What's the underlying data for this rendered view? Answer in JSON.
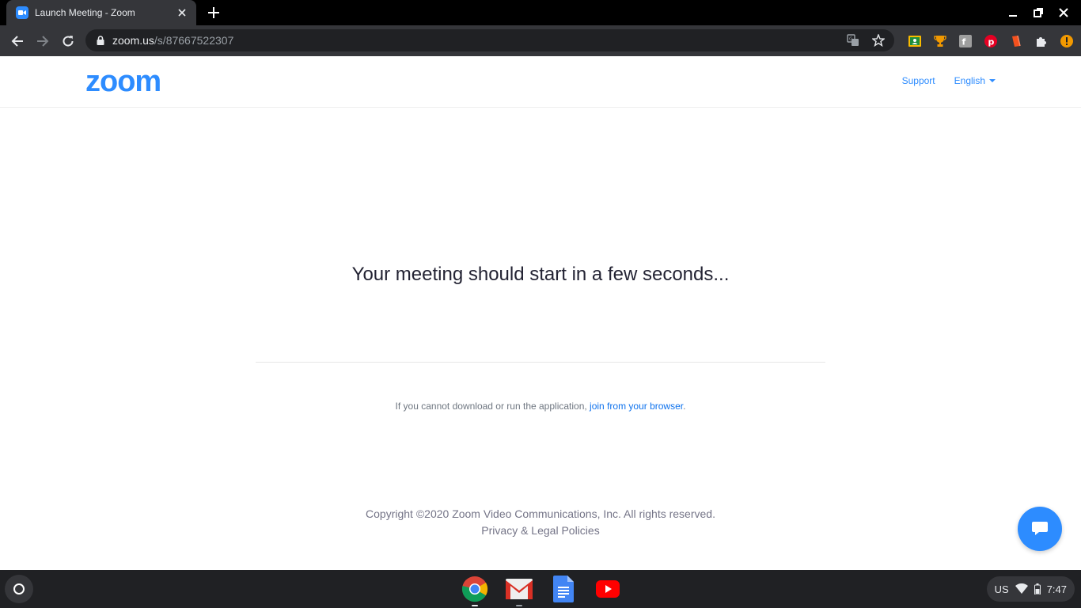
{
  "browser": {
    "tab_title": "Launch Meeting - Zoom",
    "url_host": "zoom.us",
    "url_path": "/s/87667522307"
  },
  "header": {
    "logo_text": "zoom",
    "support_label": "Support",
    "language_label": "English"
  },
  "main": {
    "headline": "Your meeting should start in a few seconds...",
    "help_prefix": "If you cannot download or run the application, ",
    "help_link": "join from your browser",
    "help_suffix": "."
  },
  "footer": {
    "copyright": "Copyright ©2020 Zoom Video Communications, Inc. All rights reserved.",
    "privacy": "Privacy & Legal Policies"
  },
  "shelf": {
    "apps": [
      "chrome-icon",
      "gmail-icon",
      "docs-icon",
      "youtube-icon"
    ],
    "keyboard_layout": "US",
    "time": "7:47"
  },
  "colors": {
    "zoom_blue": "#2D8CFF",
    "link_blue": "#0E72ED",
    "headline": "#232333",
    "chrome_toolbar": "#35363A",
    "shelf": "#202124"
  }
}
